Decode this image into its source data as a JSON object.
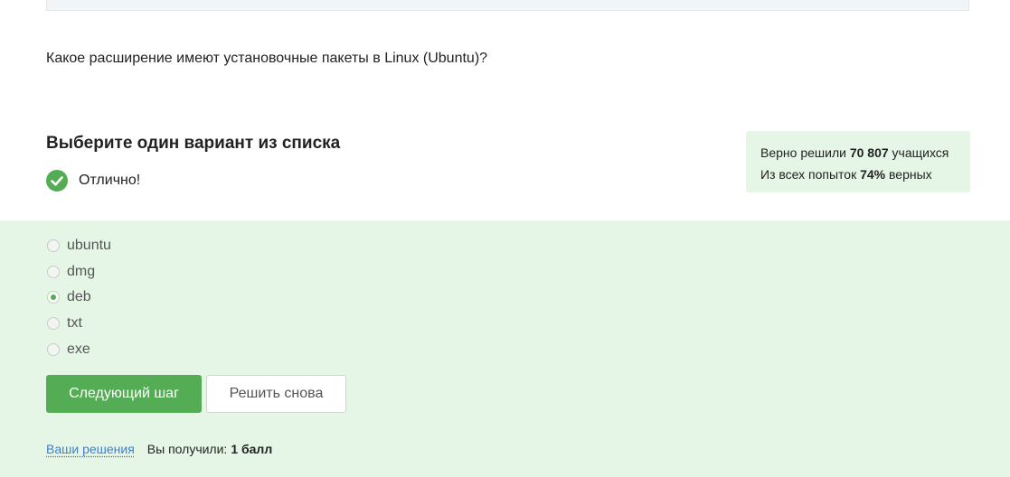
{
  "question": {
    "text": "Какое расширение имеют установочные пакеты в Linux (Ubuntu)?"
  },
  "task": {
    "heading": "Выберите один вариант из списка",
    "result_label": "Отлично!"
  },
  "stats": {
    "line1_prefix": "Верно решили",
    "solved_count": "70 807",
    "line1_suffix": "учащихся",
    "line2_prefix": "Из всех попыток",
    "percent": "74%",
    "line2_suffix": "верных"
  },
  "options": [
    {
      "label": "ubuntu",
      "checked": false
    },
    {
      "label": "dmg",
      "checked": false
    },
    {
      "label": "deb",
      "checked": true
    },
    {
      "label": "txt",
      "checked": false
    },
    {
      "label": "exe",
      "checked": false
    }
  ],
  "buttons": {
    "next_label": "Следующий шаг",
    "retry_label": "Решить снова"
  },
  "footer": {
    "solutions_link": "Ваши решения",
    "score_prefix": "Вы получили:",
    "score_value": "1 балл"
  },
  "colors": {
    "accent_green": "#54ad54",
    "success_bg": "#e6f6e6",
    "link_blue": "#3a7fd5"
  }
}
